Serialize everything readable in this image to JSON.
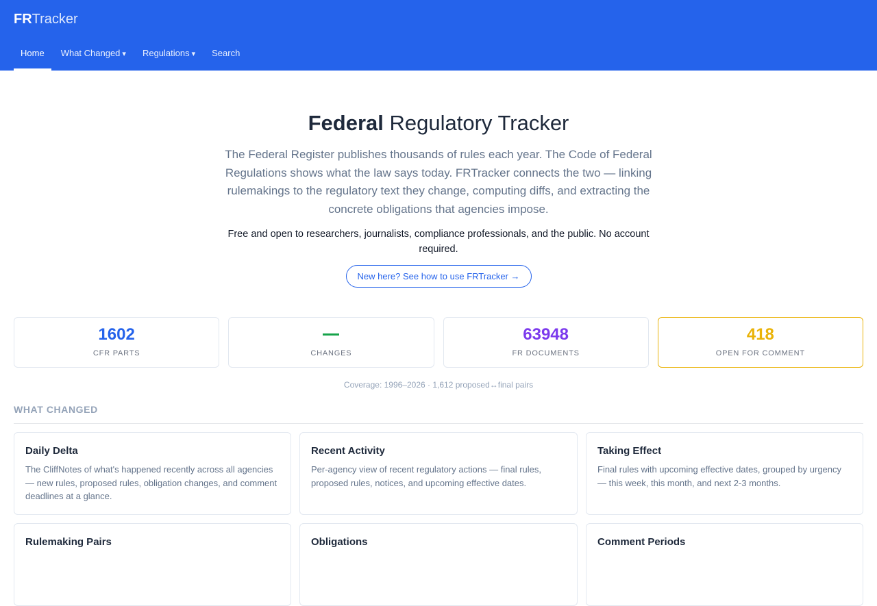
{
  "brand": {
    "bold": "FR",
    "rest": "Tracker"
  },
  "nav": [
    {
      "label": "Home",
      "active": true,
      "dropdown": false
    },
    {
      "label": "What Changed",
      "dropdown": true
    },
    {
      "label": "Regulations",
      "dropdown": true
    },
    {
      "label": "Search",
      "dropdown": false
    }
  ],
  "hero": {
    "title_bold": "Federal",
    "title_rest": " Regulatory Tracker",
    "lead": "The Federal Register publishes thousands of rules each year. The Code of Federal Regulations shows what the law says today. FRTracker connects the two — linking rulemakings to the regulatory text they change, computing diffs, and extracting the concrete obligations that agencies impose.",
    "sub": "Free and open to researchers, journalists, compliance professionals, and the public. No account required.",
    "cta": "New here? See how to use FRTracker →"
  },
  "stats": [
    {
      "value": "1602",
      "label": "CFR PARTS",
      "color": "#2563eb"
    },
    {
      "value": "",
      "label": "CHANGES",
      "color": "#16a34a"
    },
    {
      "value": "63948",
      "label": "FR DOCUMENTS",
      "color": "#7c3aed"
    },
    {
      "value": "418",
      "label": "OPEN FOR COMMENT",
      "color": "#eab308"
    }
  ],
  "coverage": "Coverage: 1996–2026 · 1,612 proposed↔final pairs",
  "section": {
    "title": "WHAT CHANGED"
  },
  "cards": [
    {
      "title": "Daily Delta",
      "desc": "The CliffNotes of what's happened recently across all agencies — new rules, proposed rules, obligation changes, and comment deadlines at a glance."
    },
    {
      "title": "Recent Activity",
      "desc": "Per-agency view of recent regulatory actions — final rules, proposed rules, notices, and upcoming effective dates."
    },
    {
      "title": "Taking Effect",
      "desc": "Final rules with upcoming effective dates, grouped by urgency — this week, this month, and next 2-3 months."
    },
    {
      "title": "Rulemaking Pairs",
      "desc": ""
    },
    {
      "title": "Obligations",
      "desc": ""
    },
    {
      "title": "Comment Periods",
      "desc": ""
    }
  ]
}
